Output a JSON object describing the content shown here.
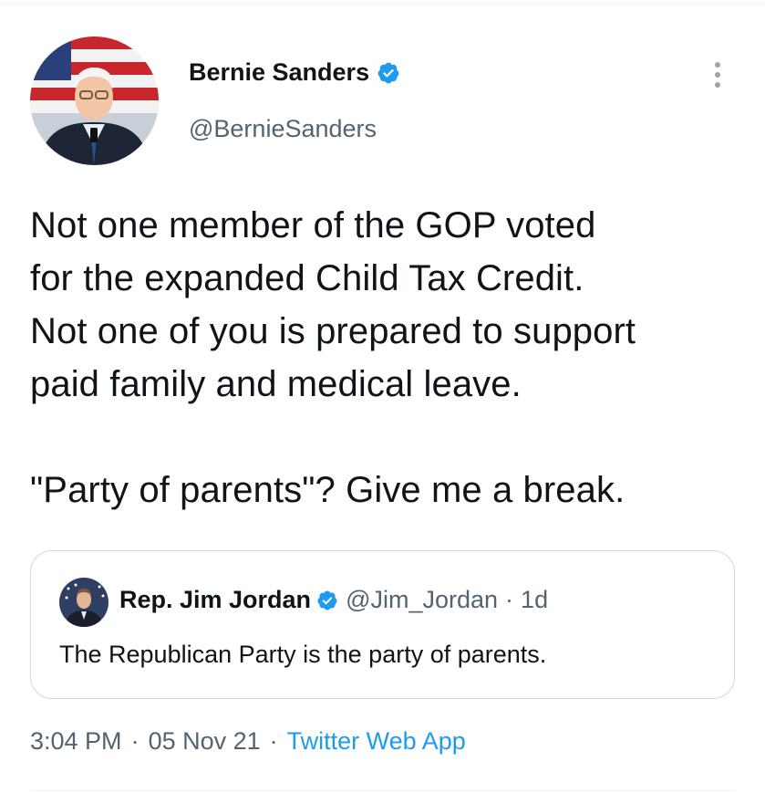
{
  "author": {
    "name": "Bernie Sanders",
    "handle": "@BernieSanders",
    "verified_icon": "verified-badge-icon",
    "avatar_icon": "avatar"
  },
  "tweet": {
    "text": "Not one member of the GOP voted\nfor the expanded Child Tax Credit.\nNot one of you is prepared to support\npaid family and medical leave.\n\n\"Party of parents\"? Give me a break."
  },
  "quote": {
    "name": "Rep. Jim Jordan",
    "handle": "@Jim_Jordan",
    "separator": "·",
    "time": "1d",
    "text": "The Republican Party is the party of parents."
  },
  "meta": {
    "time": "3:04 PM",
    "separator": "·",
    "date": "05 Nov 21",
    "source": "Twitter Web App"
  },
  "colors": {
    "accent": "#1d9bf0",
    "text": "#0f1419",
    "secondary": "#536471",
    "border": "#cfd9de"
  }
}
